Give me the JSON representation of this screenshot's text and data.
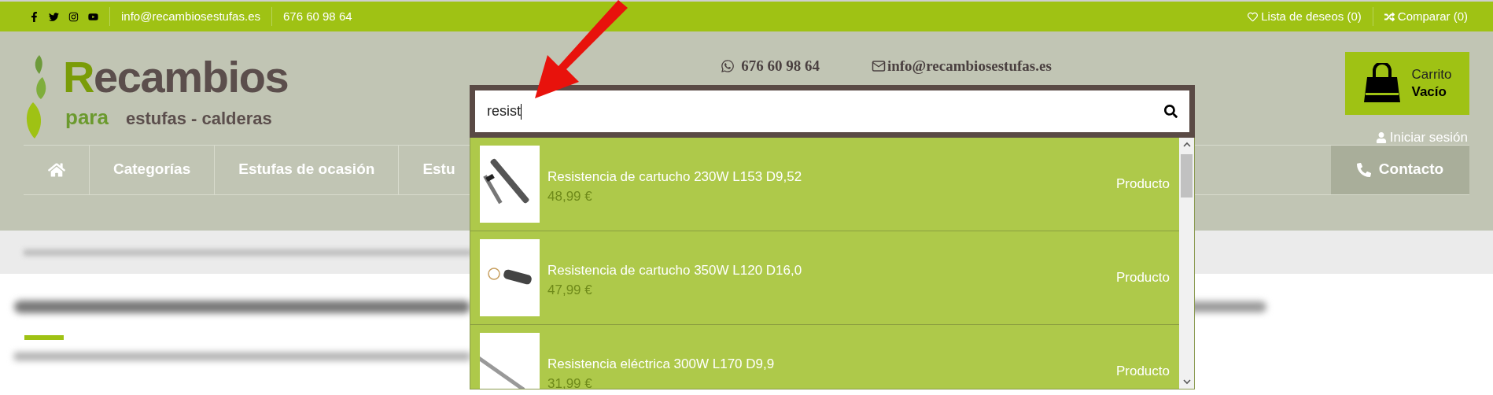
{
  "top_bar": {
    "social": [
      {
        "kind": "facebook"
      },
      {
        "kind": "twitter"
      },
      {
        "kind": "instagram"
      },
      {
        "kind": "youtube"
      }
    ],
    "email": "info@recambiosestufas.es",
    "phone": "676 60 98 64",
    "links": [
      {
        "kind": "wishlist",
        "label": "Lista de deseos (0)"
      },
      {
        "kind": "compare",
        "label": "Comparar (0)"
      }
    ]
  },
  "logo": {
    "initial": "R",
    "rest": "ecambios",
    "sub_a": "para",
    "sub_b": "estufas - calderas"
  },
  "contact": {
    "phone": "676 60 98 64",
    "email": "info@recambiosestufas.es"
  },
  "cart": {
    "label": "Carrito",
    "status": "Vacío"
  },
  "login": "Iniciar sesión",
  "nav": {
    "items": [
      {
        "kind": "home"
      },
      {
        "kind": "text",
        "label": "Categorías"
      },
      {
        "kind": "text",
        "label": "Estufas de ocasión"
      },
      {
        "kind": "text",
        "label": "Estu"
      }
    ],
    "contact": "Contacto"
  },
  "search": {
    "value": "resist",
    "results": [
      {
        "name": "Resistencia de cartucho 230W L153 D9,52",
        "price": "48,99 €",
        "type": "Producto"
      },
      {
        "name": "Resistencia de cartucho 350W L120 D16,0",
        "price": "47,99 €",
        "type": "Producto"
      },
      {
        "name": "Resistencia eléctrica 300W L170 D9,9",
        "price": "31,99 €",
        "type": "Producto"
      }
    ]
  }
}
